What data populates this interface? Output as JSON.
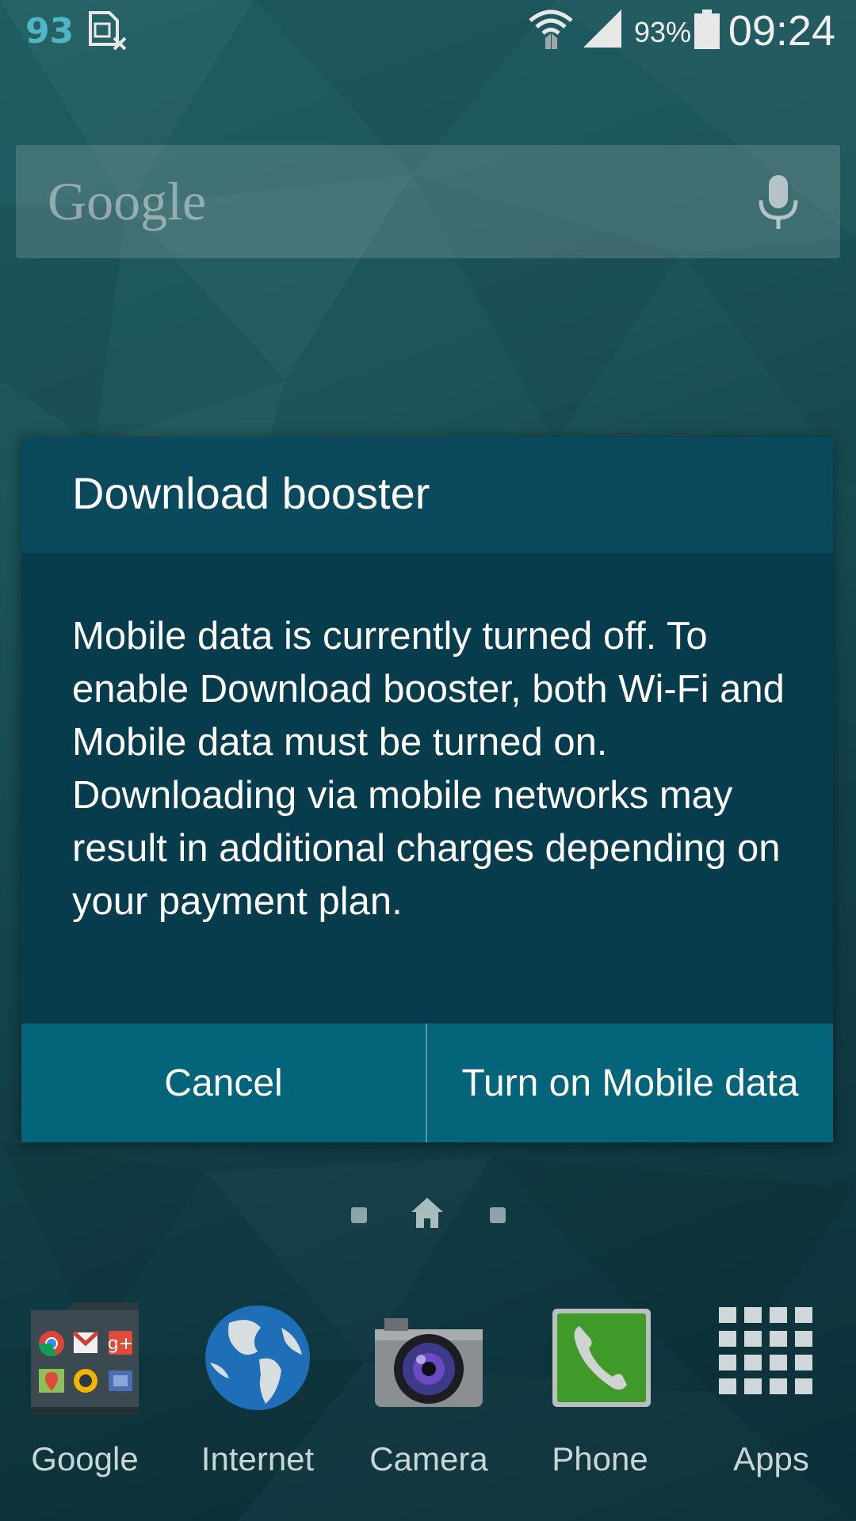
{
  "status_bar": {
    "notification_count": "93",
    "battery_percent": "93%",
    "time": "09:24",
    "icons": [
      "sim-card-missing-icon",
      "wifi-icon",
      "cellular-signal-icon",
      "battery-icon"
    ]
  },
  "search_bar": {
    "logo_text": "Google",
    "icon": "mic-icon"
  },
  "dialog": {
    "title": "Download booster",
    "message": "Mobile data is currently turned off. To enable Download booster, both Wi-Fi and Mobile data must be turned on. Downloading via mobile networks may result in additional charges depending on your payment plan.",
    "cancel_label": "Cancel",
    "confirm_label": "Turn on Mobile data"
  },
  "page_indicator": {
    "pages": [
      "dot",
      "home",
      "dot"
    ],
    "current": "home"
  },
  "dock": {
    "items": [
      {
        "label": "Google",
        "icon": "google-folder-icon"
      },
      {
        "label": "Internet",
        "icon": "globe-icon"
      },
      {
        "label": "Camera",
        "icon": "camera-icon"
      },
      {
        "label": "Phone",
        "icon": "phone-icon"
      },
      {
        "label": "Apps",
        "icon": "apps-grid-icon"
      }
    ]
  },
  "colors": {
    "dialog_header": "#0a4a5c",
    "dialog_body": "#063c4c",
    "dialog_buttons": "#046479",
    "notification_accent": "#4fb6c6"
  }
}
